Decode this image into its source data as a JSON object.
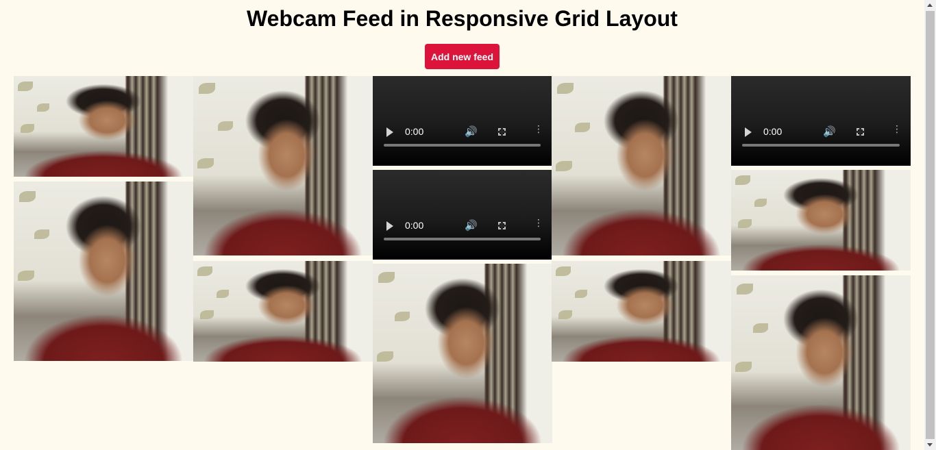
{
  "header": {
    "title": "Webcam Feed in Responsive Grid Layout",
    "add_button_label": "Add new feed"
  },
  "theme": {
    "background": "#fffaee",
    "button_color": "#dc143c",
    "button_text_color": "#ffffff"
  },
  "video_player": {
    "time": "0:00",
    "icons": [
      "play-icon",
      "volume-icon",
      "fullscreen-icon",
      "more-options-icon"
    ]
  }
}
